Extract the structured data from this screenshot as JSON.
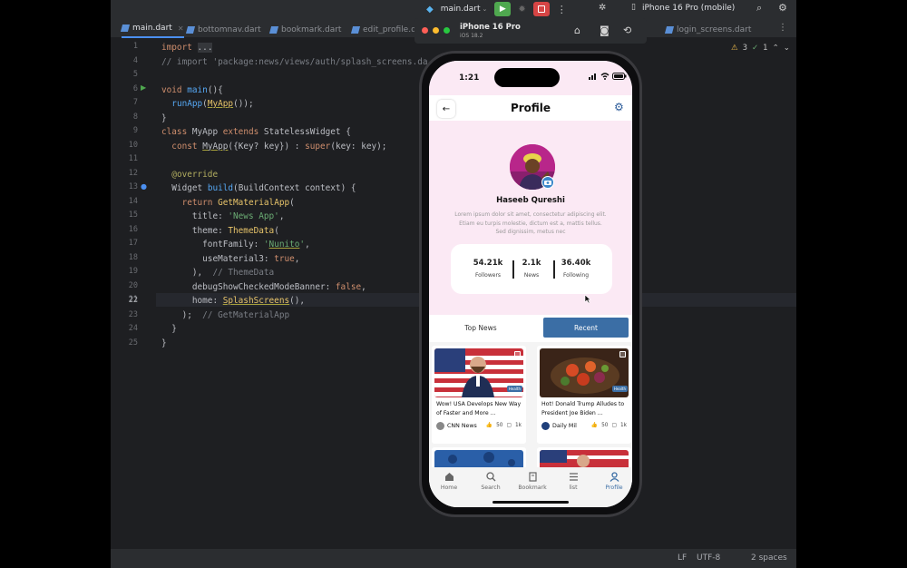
{
  "ide": {
    "run_config": "main.dart",
    "device": "iPhone 16 Pro (mobile)",
    "tabs": [
      "main.dart",
      "bottomnav.dart",
      "bookmark.dart",
      "edit_profile.da",
      "login_screens.dart"
    ],
    "inspections": {
      "warnings": "3",
      "weak": "1"
    },
    "status": {
      "line_sep": "LF",
      "encoding": "UTF-8",
      "indent": "2 spaces"
    },
    "line_numbers": [
      "1",
      "4",
      "5",
      "6",
      "7",
      "8",
      "9",
      "10",
      "11",
      "12",
      "13",
      "14",
      "15",
      "16",
      "17",
      "18",
      "19",
      "20",
      "21",
      "22",
      "23",
      "24",
      "25"
    ]
  },
  "simulator": {
    "title": "iPhone 16 Pro",
    "subtitle": "iOS 18.2"
  },
  "app": {
    "time": "1:21",
    "title": "Profile",
    "user": {
      "name": "Haseeb Qureshi",
      "bio": "Lorem ipsum dolor sit amet, consectetur adipiscing elit. Etiam eu turpis molestie, dictum est a, mattis tellus. Sed dignissim, metus nec"
    },
    "stats": [
      {
        "value": "54.21k",
        "label": "Followers"
      },
      {
        "value": "2.1k",
        "label": "News"
      },
      {
        "value": "36.40k",
        "label": "Following"
      }
    ],
    "tabs": {
      "top_news": "Top News",
      "recent": "Recent"
    },
    "cards": [
      {
        "title": "Wow! USA Develops New Way of Faster and More ...",
        "source": "CNN News",
        "likes": "50",
        "comments": "1k",
        "tag": "Health"
      },
      {
        "title": "Hot! Donald Trump Alludes to President Joe Biden ...",
        "source": "Daily Mil",
        "likes": "50",
        "comments": "1k",
        "tag": "Health"
      }
    ],
    "nav": [
      "Home",
      "Search",
      "Bookmark",
      "list",
      "Profile"
    ],
    "colors": {
      "accent": "#3b6ea5",
      "header_bg": "#fbe9f4"
    }
  }
}
